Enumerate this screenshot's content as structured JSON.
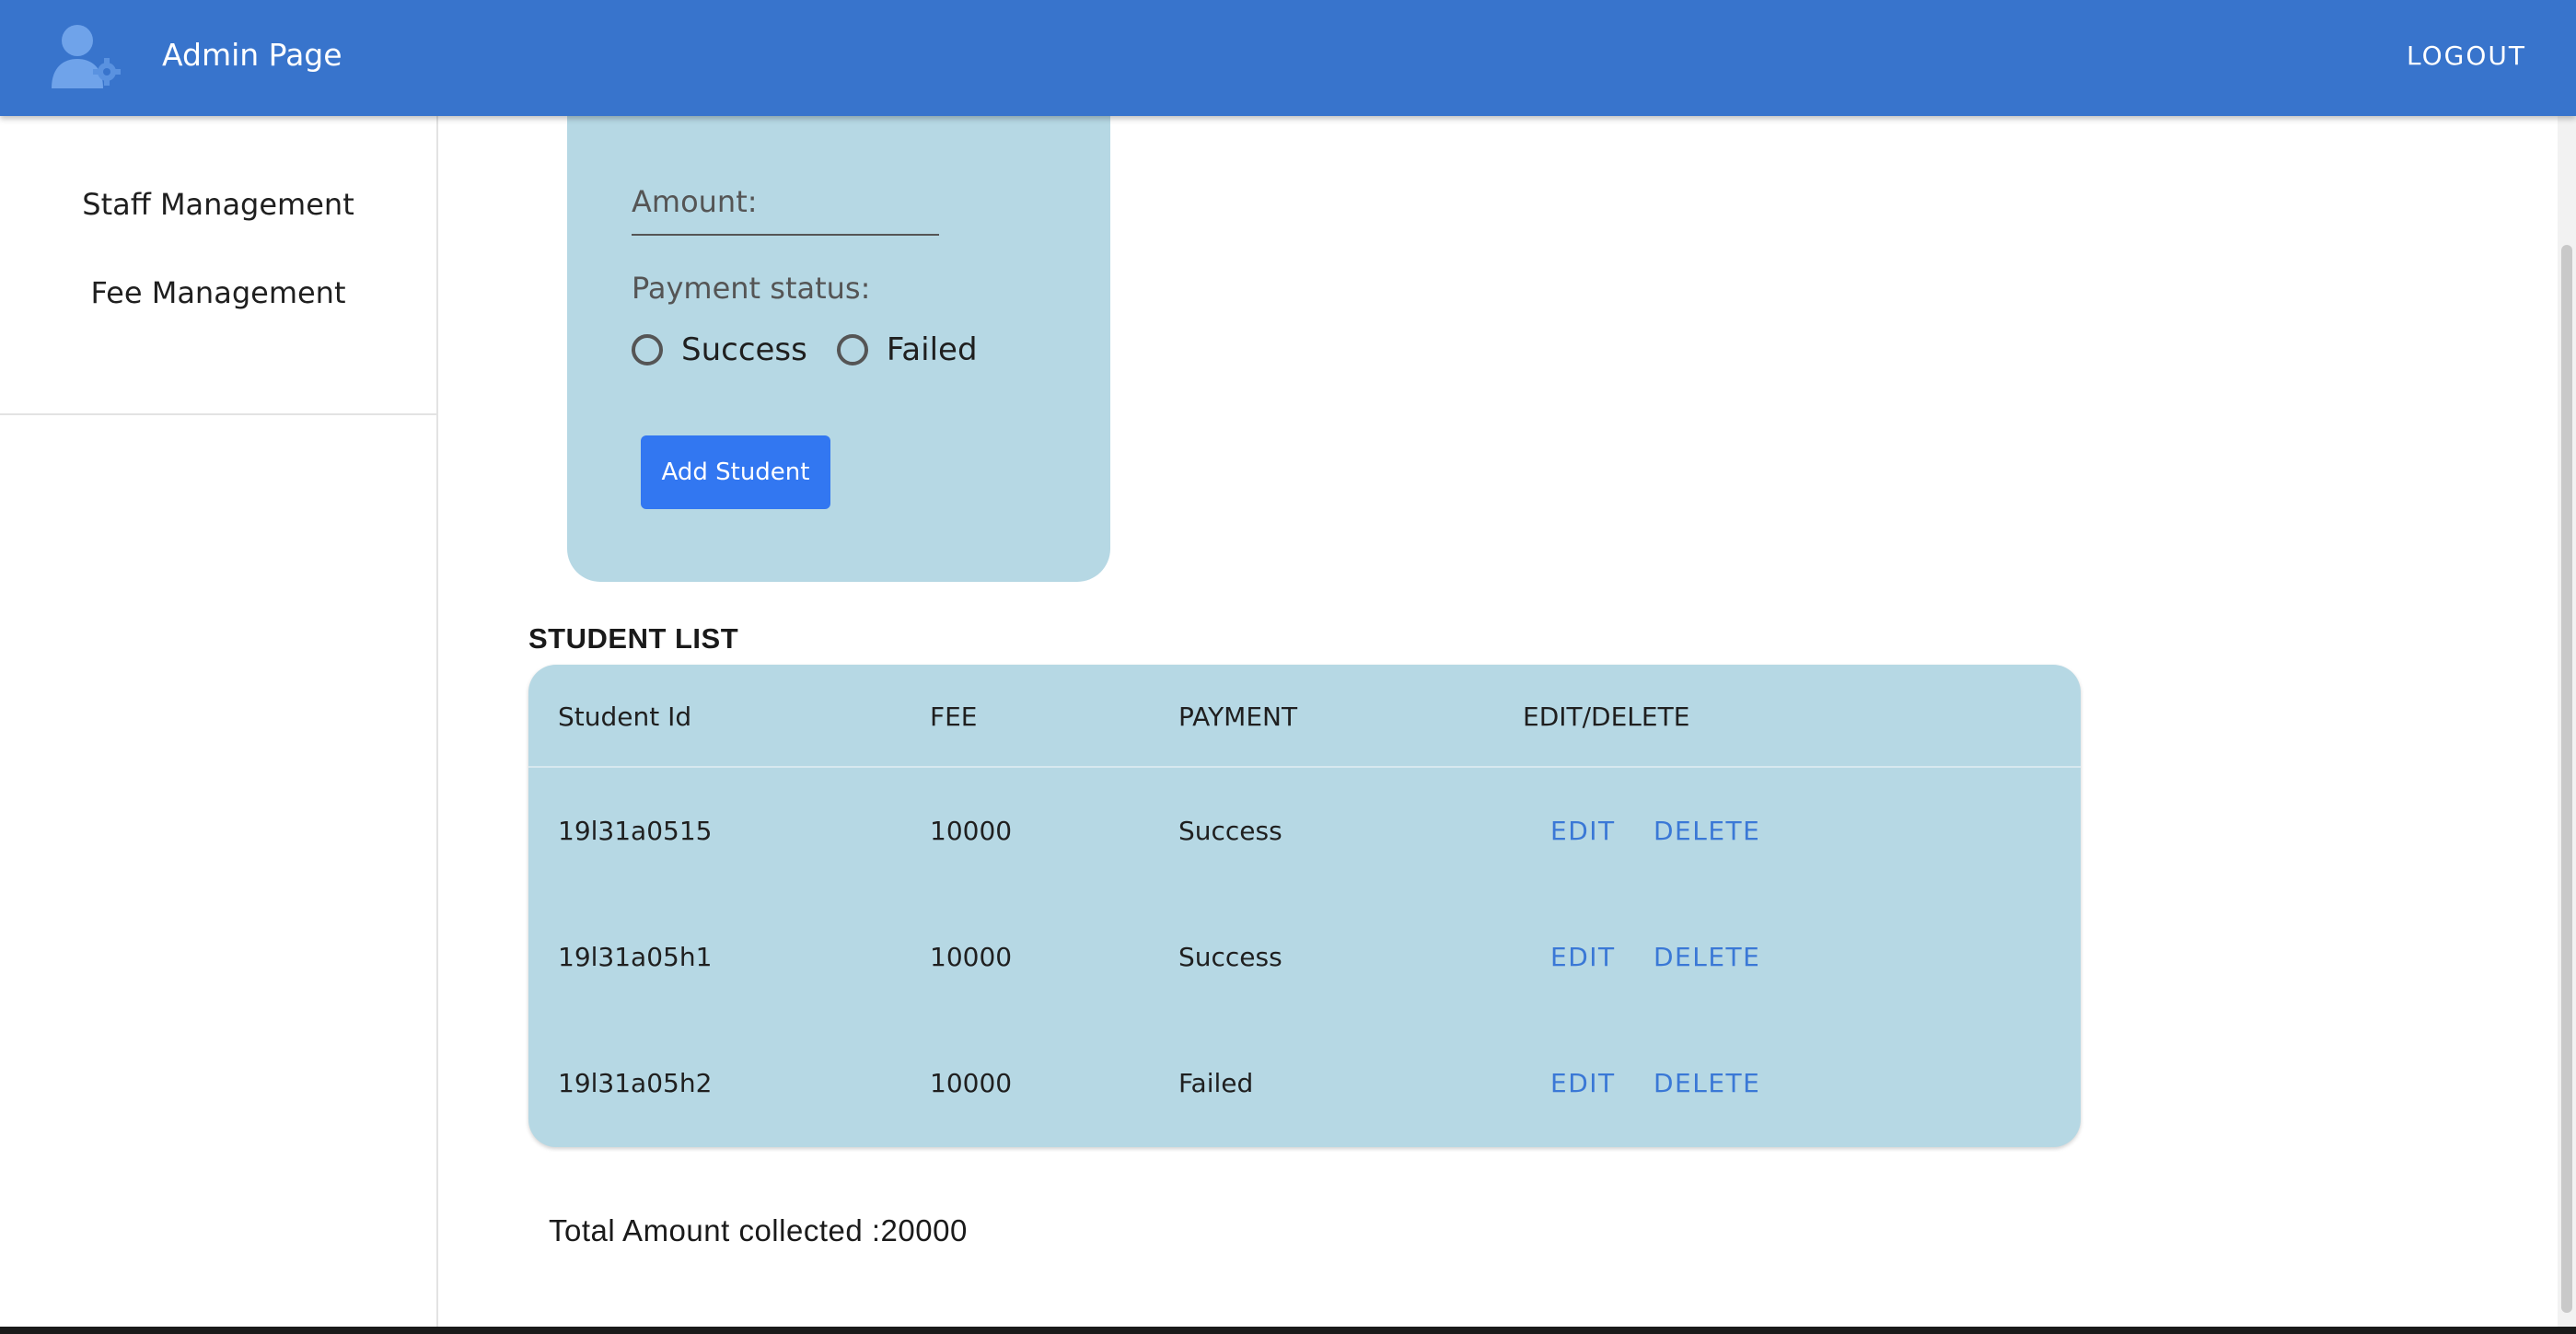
{
  "header": {
    "title": "Admin Page",
    "logout_label": "LOGOUT",
    "logo_icon": "admin-user-gear-icon"
  },
  "sidebar": {
    "items": [
      {
        "label": "Staff Management"
      },
      {
        "label": "Fee Management"
      }
    ]
  },
  "form": {
    "amount_label": "Amount:",
    "payment_status_label": "Payment status:",
    "options": [
      {
        "label": "Success",
        "selected": false
      },
      {
        "label": "Failed",
        "selected": false
      }
    ],
    "submit_label": "Add Student"
  },
  "student_list": {
    "title": "STUDENT LIST",
    "columns": [
      "Student Id",
      "FEE",
      "PAYMENT",
      "EDIT/DELETE"
    ],
    "rows": [
      {
        "id": "19l31a0515",
        "fee": "10000",
        "payment": "Success",
        "edit": "EDIT",
        "delete": "DELETE"
      },
      {
        "id": "19l31a05h1",
        "fee": "10000",
        "payment": "Success",
        "edit": "EDIT",
        "delete": "DELETE"
      },
      {
        "id": "19l31a05h2",
        "fee": "10000",
        "payment": "Failed",
        "edit": "EDIT",
        "delete": "DELETE"
      }
    ]
  },
  "total": "Total Amount collected :20000",
  "colors": {
    "header": "#3874cc",
    "card": "#b6d8e4",
    "button": "#3277f1",
    "link": "#3a78d6"
  }
}
